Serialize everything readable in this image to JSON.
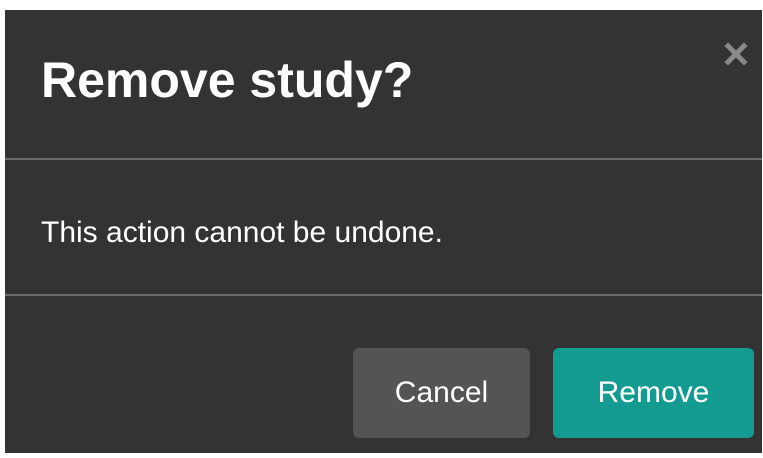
{
  "dialog": {
    "title": "Remove study?",
    "message": "This action cannot be undone.",
    "close_icon": "close-icon",
    "buttons": {
      "cancel_label": "Cancel",
      "remove_label": "Remove"
    }
  },
  "colors": {
    "dialog_background": "#333333",
    "divider": "#6a6a6a",
    "cancel_button": "#545454",
    "remove_button_accent": "#139b92",
    "close_icon": "#8a8a8a",
    "text": "#ffffff"
  }
}
